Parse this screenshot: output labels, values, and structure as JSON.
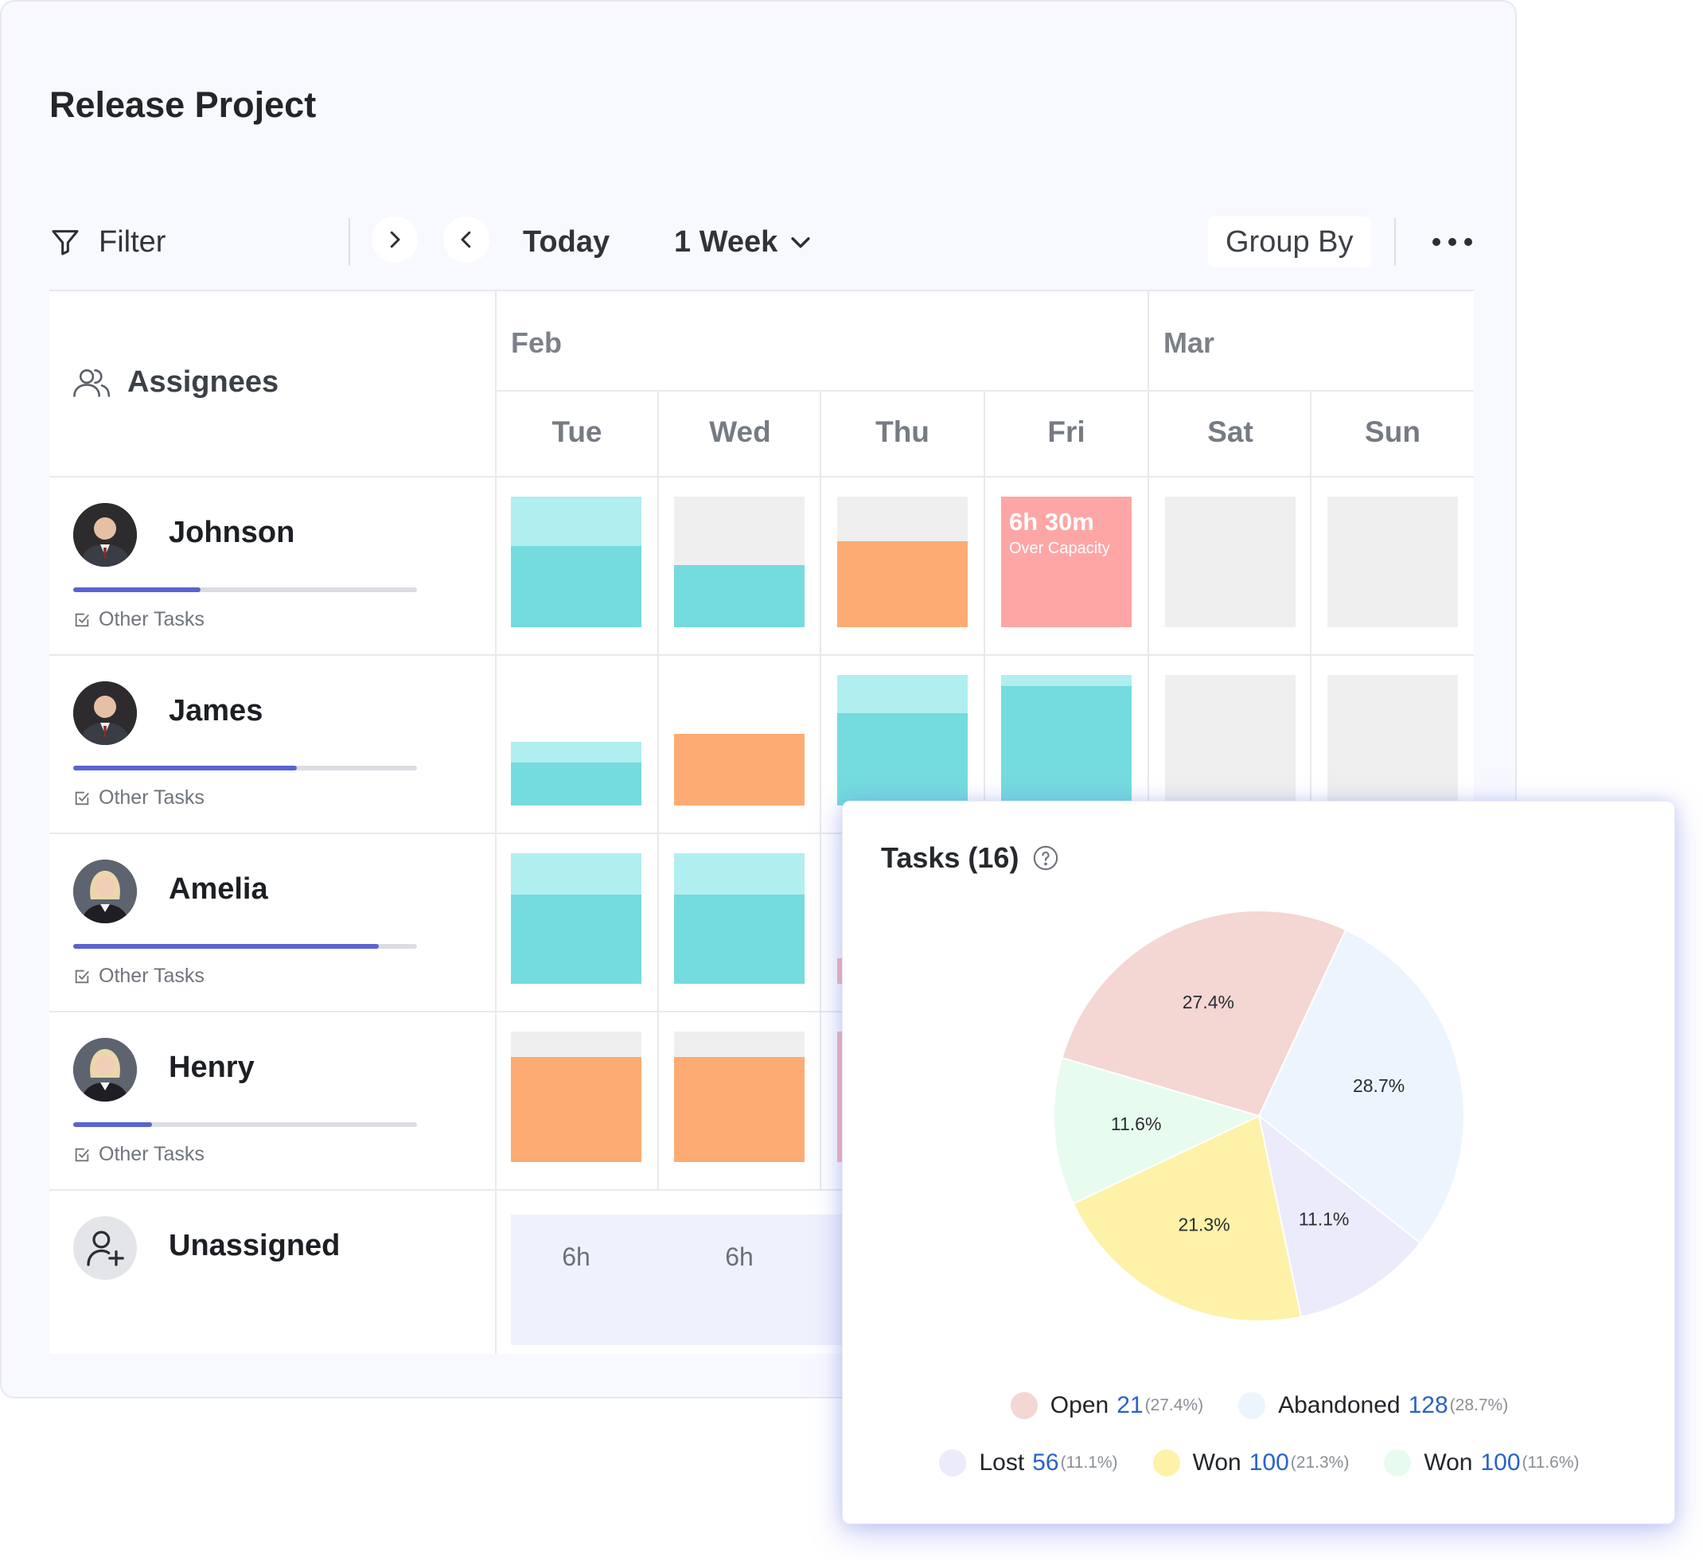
{
  "project": {
    "title": "Release Project"
  },
  "toolbar": {
    "filter": "Filter",
    "today": "Today",
    "range": "1 Week",
    "group_by": "Group By"
  },
  "grid": {
    "assignees_label": "Assignees",
    "months": [
      "Feb",
      "Mar"
    ],
    "days": [
      "Tue",
      "Wed",
      "Thu",
      "Fri",
      "Sat",
      "Sun"
    ]
  },
  "people": [
    {
      "name": "Johnson",
      "progress": 0.37,
      "other_tasks": "Other Tasks"
    },
    {
      "name": "James",
      "progress": 0.65,
      "other_tasks": "Other Tasks"
    },
    {
      "name": "Amelia",
      "progress": 0.89,
      "other_tasks": "Other Tasks"
    },
    {
      "name": "Henry",
      "progress": 0.23,
      "other_tasks": "Other Tasks"
    }
  ],
  "capacity": {
    "over_hours": "6h 30m",
    "over_label": "Over Capacity",
    "colors": {
      "teal": "#74dbde",
      "teal_light": "#b0eef0",
      "orange": "#fdab72",
      "red": "#fea6a6",
      "empty": "#efefef"
    }
  },
  "unassigned": {
    "label": "Unassigned",
    "hours": [
      "6h",
      "6h"
    ]
  },
  "tasks": {
    "title": "Tasks (16)",
    "legend": [
      {
        "label": "Open",
        "count": "21",
        "pct": "(27.4%)",
        "color": "#f4d6d3"
      },
      {
        "label": "Abandoned",
        "count": "128",
        "pct": "(28.7%)",
        "color": "#ecf5fd"
      },
      {
        "label": "Lost",
        "count": "56",
        "pct": "(11.1%)",
        "color": "#ebebfb"
      },
      {
        "label": "Won",
        "count": "100",
        "pct": "(21.3%)",
        "color": "#fdf2a8"
      },
      {
        "label": "Won",
        "count": "100",
        "pct": "(11.6%)",
        "color": "#e7fbef"
      }
    ]
  },
  "chart_data": {
    "type": "pie",
    "title": "Tasks (16)",
    "slices": [
      {
        "label": "Abandoned",
        "value": 28.7,
        "color": "#ecf5fd"
      },
      {
        "label": "Lost",
        "value": 11.1,
        "color": "#ebebfb"
      },
      {
        "label": "Won",
        "value": 21.3,
        "color": "#fdf2a8"
      },
      {
        "label": "Won",
        "value": 11.6,
        "color": "#e7fbef"
      },
      {
        "label": "Open",
        "value": 27.4,
        "color": "#f4d6d3"
      }
    ],
    "slice_labels": [
      "28.7%",
      "11.1%",
      "21.3%",
      "11.6%",
      "27.4%"
    ]
  }
}
